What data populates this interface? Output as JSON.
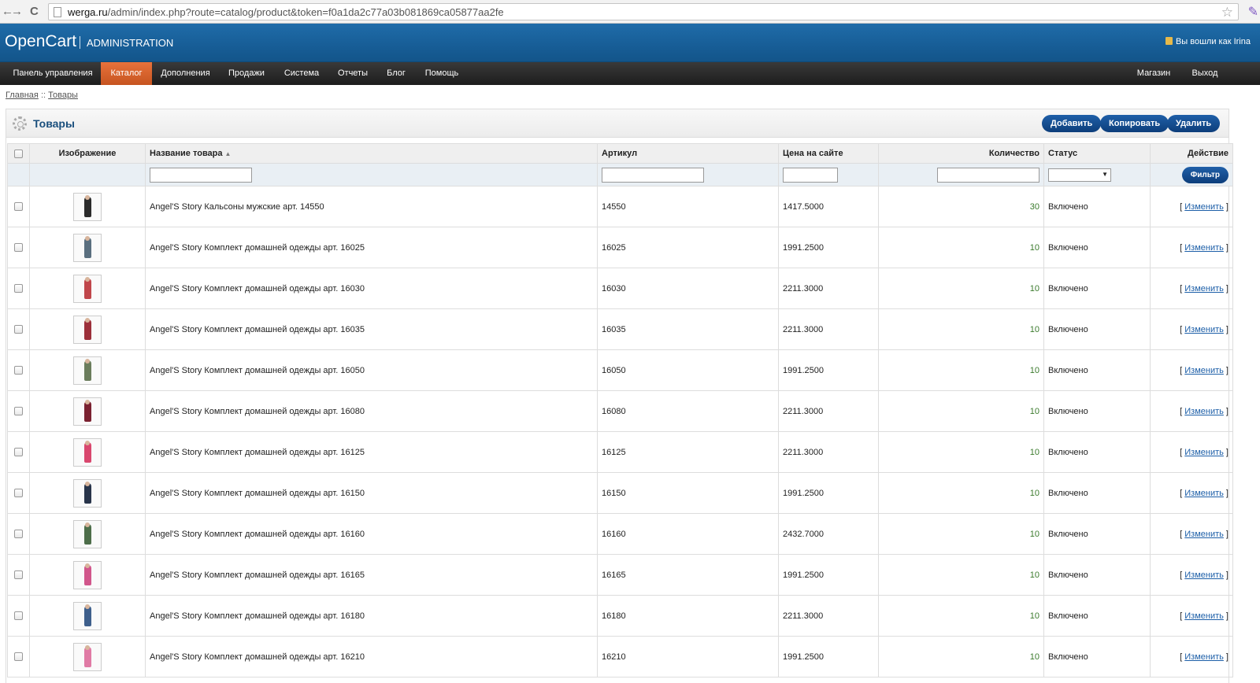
{
  "browser": {
    "back": "←",
    "forward": "→",
    "reload": "C",
    "url_host": "werga.ru",
    "url_path": "/admin/index.php?route=catalog/product&token=f0a1da2c77a03b081869ca05877aa2fe"
  },
  "header": {
    "logo": "OpenCart",
    "subtitle": "ADMINISTRATION",
    "logged_in": "Вы вошли как Irina"
  },
  "menu": {
    "items": [
      "Панель управления",
      "Каталог",
      "Дополнения",
      "Продажи",
      "Система",
      "Отчеты",
      "Блог",
      "Помощь"
    ],
    "right": [
      "Магазин",
      "Выход"
    ]
  },
  "breadcrumb": {
    "home": "Главная",
    "sep": "::",
    "current": "Товары"
  },
  "page": {
    "title": "Товары",
    "add_label": "Добавить",
    "copy_label": "Копировать",
    "delete_label": "Удалить"
  },
  "table": {
    "headers": {
      "image": "Изображение",
      "name": "Название товара",
      "sku": "Артикул",
      "price": "Цена на сайте",
      "qty": "Количество",
      "status": "Статус",
      "action": "Действие"
    },
    "filter_label": "Фильтр",
    "edit_label": "Изменить",
    "rows": [
      {
        "name": "Angel'S Story Кальсоны мужские арт. 14550",
        "sku": "14550",
        "price": "1417.5000",
        "qty": "30",
        "status": "Включено",
        "color": "#2b2b2b"
      },
      {
        "name": "Angel'S Story Комплект домашней одежды арт. 16025",
        "sku": "16025",
        "price": "1991.2500",
        "qty": "10",
        "status": "Включено",
        "color": "#5a6f7f"
      },
      {
        "name": "Angel'S Story Комплект домашней одежды арт. 16030",
        "sku": "16030",
        "price": "2211.3000",
        "qty": "10",
        "status": "Включено",
        "color": "#c0464b"
      },
      {
        "name": "Angel'S Story Комплект домашней одежды арт. 16035",
        "sku": "16035",
        "price": "2211.3000",
        "qty": "10",
        "status": "Включено",
        "color": "#9c2f3a"
      },
      {
        "name": "Angel'S Story Комплект домашней одежды арт. 16050",
        "sku": "16050",
        "price": "1991.2500",
        "qty": "10",
        "status": "Включено",
        "color": "#6b7d5c"
      },
      {
        "name": "Angel'S Story Комплект домашней одежды арт. 16080",
        "sku": "16080",
        "price": "2211.3000",
        "qty": "10",
        "status": "Включено",
        "color": "#7a2130"
      },
      {
        "name": "Angel'S Story Комплект домашней одежды арт. 16125",
        "sku": "16125",
        "price": "2211.3000",
        "qty": "10",
        "status": "Включено",
        "color": "#d9476e"
      },
      {
        "name": "Angel'S Story Комплект домашней одежды арт. 16150",
        "sku": "16150",
        "price": "1991.2500",
        "qty": "10",
        "status": "Включено",
        "color": "#28344a"
      },
      {
        "name": "Angel'S Story Комплект домашней одежды арт. 16160",
        "sku": "16160",
        "price": "2432.7000",
        "qty": "10",
        "status": "Включено",
        "color": "#4d6e4a"
      },
      {
        "name": "Angel'S Story Комплект домашней одежды арт. 16165",
        "sku": "16165",
        "price": "1991.2500",
        "qty": "10",
        "status": "Включено",
        "color": "#d1568b"
      },
      {
        "name": "Angel'S Story Комплект домашней одежды арт. 16180",
        "sku": "16180",
        "price": "2211.3000",
        "qty": "10",
        "status": "Включено",
        "color": "#3e5f8c"
      },
      {
        "name": "Angel'S Story Комплект домашней одежды арт. 16210",
        "sku": "16210",
        "price": "1991.2500",
        "qty": "10",
        "status": "Включено",
        "color": "#e07aa5"
      }
    ]
  }
}
